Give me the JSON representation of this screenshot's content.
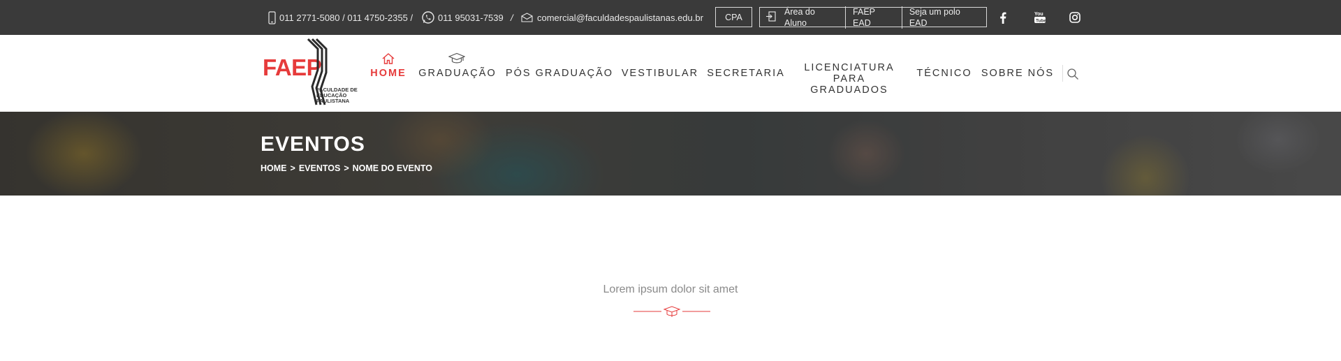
{
  "topbar": {
    "phones": "011 2771-5080 / 011 4750-2355 /",
    "whatsapp": "011 95031-7539",
    "separator": "/",
    "email": "comercial@faculdadespaulistanas.edu.br",
    "cpa_label": "CPA",
    "links": [
      "Área do Aluno",
      "FAEP EAD",
      "Seja um polo EAD"
    ],
    "social": [
      "facebook-icon",
      "youtube-icon",
      "instagram-icon"
    ]
  },
  "logo": {
    "name": "FAEP",
    "subtitle": "FACULDADE DE EDUCAÇÃO PAULISTANA"
  },
  "nav": {
    "items": [
      {
        "label": "HOME",
        "active": true,
        "icon": "home-icon"
      },
      {
        "label": "GRADUAÇÃO",
        "active": false,
        "icon": "graduation-cap-icon"
      },
      {
        "label": "PÓS GRADUAÇÃO",
        "active": false
      },
      {
        "label": "VESTIBULAR",
        "active": false
      },
      {
        "label": "SECRETARIA",
        "active": false
      },
      {
        "label": "LICENCIATURA PARA GRADUADOS",
        "active": false
      },
      {
        "label": "TÉCNICO",
        "active": false
      },
      {
        "label": "SOBRE NÓS",
        "active": false
      }
    ],
    "search_icon": "search-icon"
  },
  "hero": {
    "title": "EVENTOS",
    "breadcrumb": [
      "HOME",
      "EVENTOS",
      "NOME DO EVENTO"
    ],
    "breadcrumb_separator": ">"
  },
  "section": {
    "title": "Lorem ipsum dolor sit amet",
    "divider_icon": "graduation-cap-icon"
  },
  "colors": {
    "accent": "#e63b3b",
    "topbar_bg": "#3a3a3a",
    "text_dark": "#333333"
  }
}
